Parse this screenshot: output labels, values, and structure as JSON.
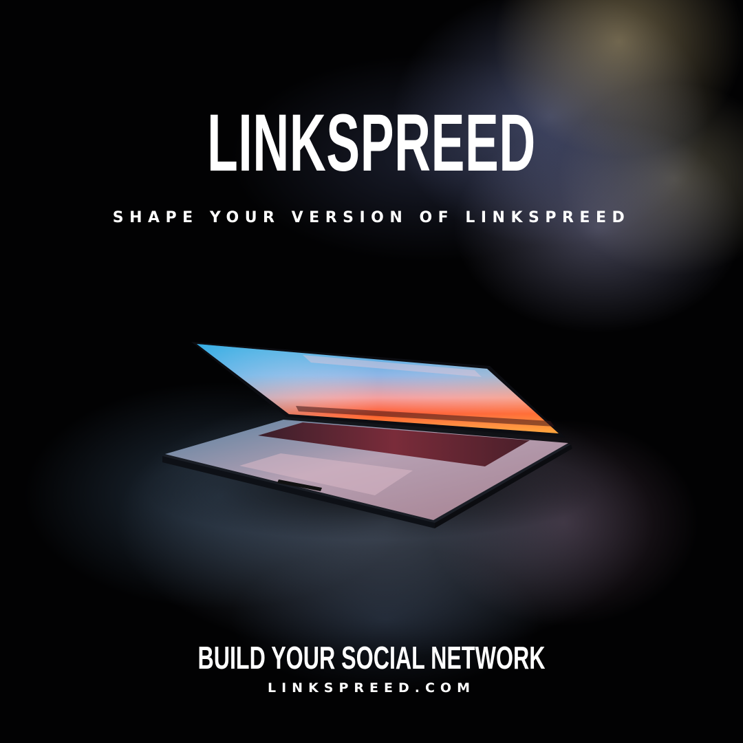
{
  "brand": {
    "title": "LINKSPREED",
    "tagline": "SHAPE YOUR VERSION OF LINKSPREED"
  },
  "footer": {
    "cta": "BUILD YOUR SOCIAL NETWORK",
    "url": "LINKSPREED.COM"
  },
  "colors": {
    "background": "#020203",
    "text": "#ffffff",
    "screen_top": "#3aa7d8",
    "screen_mid": "#ff6a3a",
    "screen_bottom": "#ff9a2a"
  },
  "image": {
    "subject": "laptop-icon"
  }
}
